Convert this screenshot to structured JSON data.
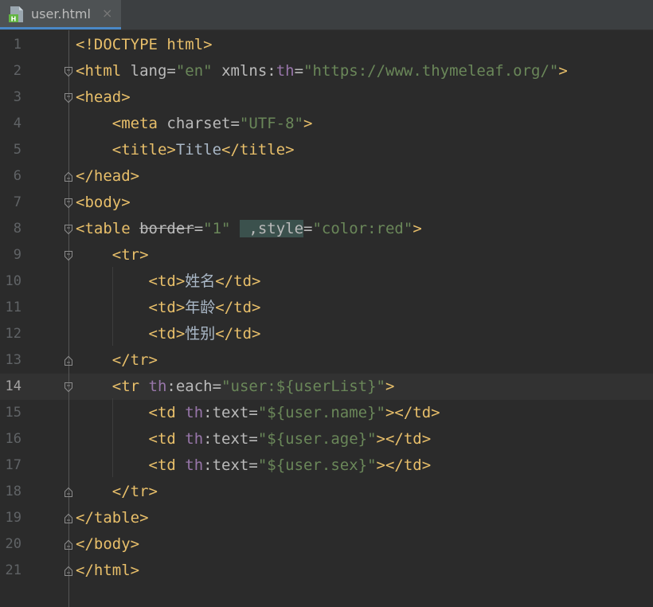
{
  "tab": {
    "file_name": "user.html",
    "close_glyph": "×",
    "icon": "html-file-icon"
  },
  "editor": {
    "active_line": 14,
    "lines": [
      {
        "num": "1",
        "fold": "none",
        "tokens": [
          {
            "t": "<!DOCTYPE html>",
            "c": "tag"
          }
        ]
      },
      {
        "num": "2",
        "fold": "open",
        "tokens": [
          {
            "t": "<html ",
            "c": "tag"
          },
          {
            "t": "lang",
            "c": "attr"
          },
          {
            "t": "=",
            "c": "attr"
          },
          {
            "t": "\"en\"",
            "c": "val"
          },
          {
            "t": " ",
            "c": "attr"
          },
          {
            "t": "xmlns:",
            "c": "attr"
          },
          {
            "t": "th",
            "c": "ns"
          },
          {
            "t": "=",
            "c": "attr"
          },
          {
            "t": "\"https://www.thymeleaf.org/\"",
            "c": "val"
          },
          {
            "t": ">",
            "c": "tag"
          }
        ]
      },
      {
        "num": "3",
        "fold": "open",
        "tokens": [
          {
            "t": "<head>",
            "c": "tag"
          }
        ]
      },
      {
        "num": "4",
        "fold": "none",
        "tokens": [
          {
            "t": "    <meta ",
            "c": "tag"
          },
          {
            "t": "charset",
            "c": "attr"
          },
          {
            "t": "=",
            "c": "attr"
          },
          {
            "t": "\"UTF-8\"",
            "c": "val"
          },
          {
            "t": ">",
            "c": "tag"
          }
        ]
      },
      {
        "num": "5",
        "fold": "none",
        "tokens": [
          {
            "t": "    <title>",
            "c": "tag"
          },
          {
            "t": "Title",
            "c": "cn"
          },
          {
            "t": "</title>",
            "c": "tag"
          }
        ]
      },
      {
        "num": "6",
        "fold": "close",
        "tokens": [
          {
            "t": "</head>",
            "c": "tag"
          }
        ]
      },
      {
        "num": "7",
        "fold": "open",
        "tokens": [
          {
            "t": "<body>",
            "c": "tag"
          }
        ]
      },
      {
        "num": "8",
        "fold": "open",
        "tokens": [
          {
            "t": "<table ",
            "c": "tag"
          },
          {
            "t": "border",
            "c": "attr strike"
          },
          {
            "t": "=",
            "c": "attr"
          },
          {
            "t": "\"1\"",
            "c": "val"
          },
          {
            "t": " ",
            "c": "attr"
          },
          {
            "t": " ,style",
            "c": "attr hl"
          },
          {
            "t": "=",
            "c": "attr"
          },
          {
            "t": "\"color:red\"",
            "c": "val"
          },
          {
            "t": ">",
            "c": "tag"
          }
        ]
      },
      {
        "num": "9",
        "fold": "open",
        "tokens": [
          {
            "t": "    <tr>",
            "c": "tag"
          }
        ]
      },
      {
        "num": "10",
        "fold": "none",
        "tokens": [
          {
            "t": "        <td>",
            "c": "tag"
          },
          {
            "t": "姓名",
            "c": "cn"
          },
          {
            "t": "</td>",
            "c": "tag"
          }
        ]
      },
      {
        "num": "11",
        "fold": "none",
        "tokens": [
          {
            "t": "        <td>",
            "c": "tag"
          },
          {
            "t": "年龄",
            "c": "cn"
          },
          {
            "t": "</td>",
            "c": "tag"
          }
        ]
      },
      {
        "num": "12",
        "fold": "none",
        "tokens": [
          {
            "t": "        <td>",
            "c": "tag"
          },
          {
            "t": "性别",
            "c": "cn"
          },
          {
            "t": "</td>",
            "c": "tag"
          }
        ]
      },
      {
        "num": "13",
        "fold": "close",
        "tokens": [
          {
            "t": "    </tr>",
            "c": "tag"
          }
        ]
      },
      {
        "num": "14",
        "fold": "open",
        "tokens": [
          {
            "t": "    <tr ",
            "c": "tag"
          },
          {
            "t": "th",
            "c": "ns"
          },
          {
            "t": ":each",
            "c": "attr"
          },
          {
            "t": "=",
            "c": "attr"
          },
          {
            "t": "\"user:${userList}\"",
            "c": "val"
          },
          {
            "t": ">",
            "c": "tag"
          }
        ]
      },
      {
        "num": "15",
        "fold": "none",
        "tokens": [
          {
            "t": "        <td ",
            "c": "tag"
          },
          {
            "t": "th",
            "c": "ns"
          },
          {
            "t": ":text",
            "c": "attr"
          },
          {
            "t": "=",
            "c": "attr"
          },
          {
            "t": "\"${user.name}\"",
            "c": "val"
          },
          {
            "t": "></td>",
            "c": "tag"
          }
        ]
      },
      {
        "num": "16",
        "fold": "none",
        "tokens": [
          {
            "t": "        <td ",
            "c": "tag"
          },
          {
            "t": "th",
            "c": "ns"
          },
          {
            "t": ":text",
            "c": "attr"
          },
          {
            "t": "=",
            "c": "attr"
          },
          {
            "t": "\"${user.age}\"",
            "c": "val"
          },
          {
            "t": "></td>",
            "c": "tag"
          }
        ]
      },
      {
        "num": "17",
        "fold": "none",
        "tokens": [
          {
            "t": "        <td ",
            "c": "tag"
          },
          {
            "t": "th",
            "c": "ns"
          },
          {
            "t": ":text",
            "c": "attr"
          },
          {
            "t": "=",
            "c": "attr"
          },
          {
            "t": "\"${user.sex}\"",
            "c": "val"
          },
          {
            "t": "></td>",
            "c": "tag"
          }
        ]
      },
      {
        "num": "18",
        "fold": "close",
        "tokens": [
          {
            "t": "    </tr>",
            "c": "tag"
          }
        ]
      },
      {
        "num": "19",
        "fold": "close",
        "tokens": [
          {
            "t": "</table>",
            "c": "tag"
          }
        ]
      },
      {
        "num": "20",
        "fold": "close",
        "tokens": [
          {
            "t": "</body>",
            "c": "tag"
          }
        ]
      },
      {
        "num": "21",
        "fold": "close",
        "tokens": [
          {
            "t": "</html>",
            "c": "tag"
          }
        ]
      }
    ]
  },
  "colors": {
    "background": "#2b2b2b",
    "tag": "#e8bf6a",
    "attribute": "#bababa",
    "string": "#6a8759",
    "namespace": "#9876aa",
    "text": "#a9b7c6"
  }
}
